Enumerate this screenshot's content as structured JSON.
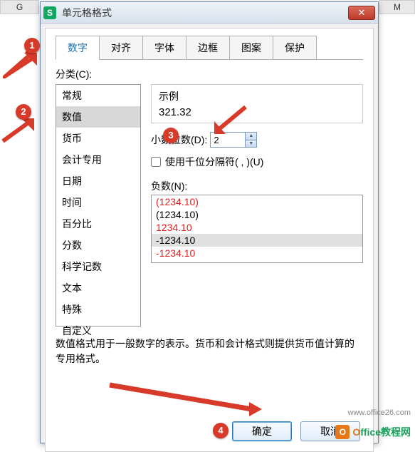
{
  "bg": {
    "col_g": "G",
    "col_m": "M"
  },
  "titlebar": {
    "title": "单元格格式",
    "close": "✕"
  },
  "tabs": [
    "数字",
    "对齐",
    "字体",
    "边框",
    "图案",
    "保护"
  ],
  "category_label": "分类(C):",
  "categories": [
    "常规",
    "数值",
    "货币",
    "会计专用",
    "日期",
    "时间",
    "百分比",
    "分数",
    "科学记数",
    "文本",
    "特殊",
    "自定义"
  ],
  "example": {
    "label": "示例",
    "value": "321.32"
  },
  "decimal": {
    "label": "小数位数(D):",
    "value": "2"
  },
  "thousands": {
    "label": "使用千位分隔符( , )(U)"
  },
  "negatives": {
    "label": "负数(N):",
    "items": [
      {
        "text": "(1234.10)",
        "red": true
      },
      {
        "text": "(1234.10)",
        "red": false
      },
      {
        "text": "1234.10",
        "red": true
      },
      {
        "text": "-1234.10",
        "red": false,
        "selected": true
      },
      {
        "text": "-1234.10",
        "red": true
      }
    ]
  },
  "description": "数值格式用于一般数字的表示。货币和会计格式则提供货币值计算的专用格式。",
  "buttons": {
    "ok": "确定",
    "cancel": "取消"
  },
  "callouts": {
    "c1": "1",
    "c2": "2",
    "c3": "3",
    "c4": "4"
  },
  "watermark": {
    "brand_o": "O",
    "brand_rest": "ffice教程网",
    "url": "www.office26.com"
  }
}
